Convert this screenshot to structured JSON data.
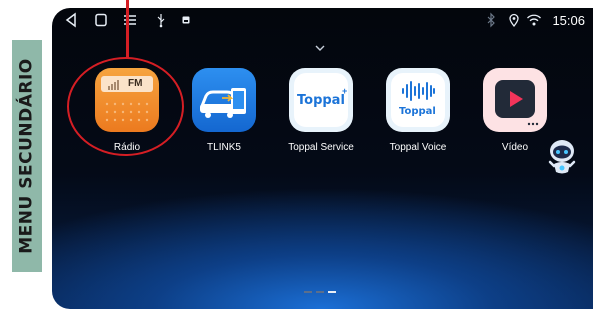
{
  "annotation": {
    "label": "MENU SECUNDÁRIO"
  },
  "status_bar": {
    "time": "15:06",
    "icons": [
      "back-icon",
      "home-icon",
      "menu-icon",
      "usb-icon",
      "media-icon",
      "bluetooth-icon",
      "location-icon",
      "wifi-icon"
    ]
  },
  "apps": [
    {
      "label": "Rádio",
      "icon": "radio-icon",
      "badge": "FM"
    },
    {
      "label": "TLINK5",
      "icon": "tlink5-icon"
    },
    {
      "label": "Toppal Service",
      "icon": "toppal-service-icon",
      "badge": "Toppal"
    },
    {
      "label": "Toppal Voice",
      "icon": "toppal-voice-icon",
      "badge": "Toppal"
    },
    {
      "label": "Vídeo",
      "icon": "video-icon"
    }
  ],
  "pager": {
    "pages": 3,
    "active_index": 2
  },
  "colors": {
    "annotation_band": "#8fb8a9",
    "highlight": "#d51e24",
    "screen_glow": "#1b6fd6"
  }
}
